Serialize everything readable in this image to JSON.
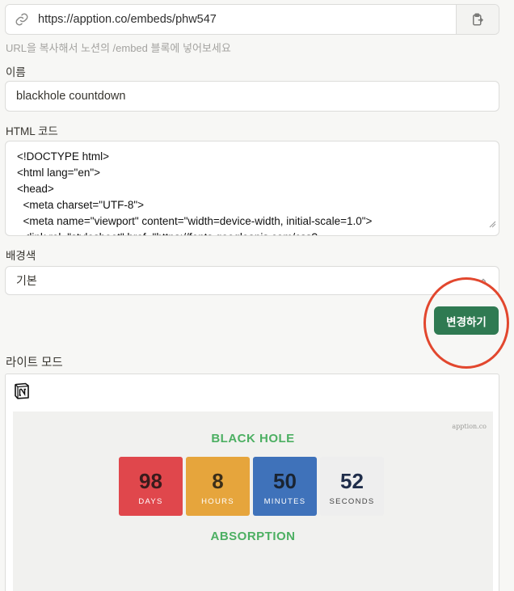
{
  "embed_url": {
    "value": "https://apption.co/embeds/phw547",
    "icon": "link-icon",
    "copy_icon": "clipboard-icon"
  },
  "hint": "URL을 복사해서 노션의 /embed 블록에 넣어보세요",
  "name_field": {
    "label": "이름",
    "value": "blackhole countdown"
  },
  "html_code": {
    "label": "HTML 코드",
    "lines": [
      "<!DOCTYPE html>",
      "<html lang=\"en\">",
      "<head>",
      "  <meta charset=\"UTF-8\">",
      "  <meta name=\"viewport\" content=\"width=device-width, initial-scale=1.0\">",
      "  <link rel=\"stylesheet\" href=\"https://fonts.googleapis.com/css?"
    ]
  },
  "background": {
    "label": "배경색",
    "value": "기본"
  },
  "change_button": "변경하기",
  "preview": {
    "label": "라이트 모드",
    "brand": "apption.co",
    "title_top": "BLACK HOLE",
    "title_bottom": "ABSORPTION",
    "tiles": [
      {
        "num": "98",
        "label": "DAYS",
        "color": "#e0474c"
      },
      {
        "num": "8",
        "label": "HOURS",
        "color": "#e6a53c"
      },
      {
        "num": "50",
        "label": "MINUTES",
        "color": "#3f72ba"
      },
      {
        "num": "52",
        "label": "SECONDS",
        "color": "#eeeeee"
      }
    ]
  },
  "colors": {
    "accent": "#2f7a52",
    "title_green": "#4caf62",
    "annotation_red": "#e2472e"
  }
}
